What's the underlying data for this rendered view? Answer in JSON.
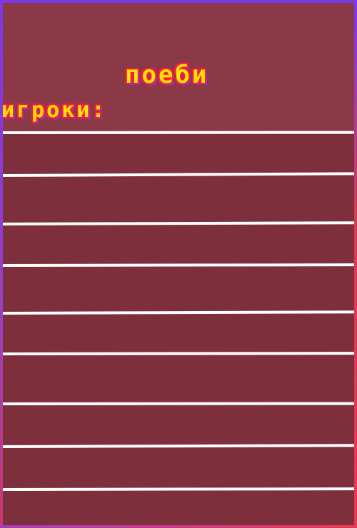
{
  "title": "поеби",
  "players_label": "игроки:",
  "player_slots": [
    "",
    "",
    "",
    "",
    "",
    "",
    "",
    "",
    ""
  ],
  "colors": {
    "background": "#7d303b",
    "header_background": "#8c3947",
    "text_fill": "#ffe600",
    "text_outline": "#ff1744",
    "divider": "#ffffff"
  }
}
